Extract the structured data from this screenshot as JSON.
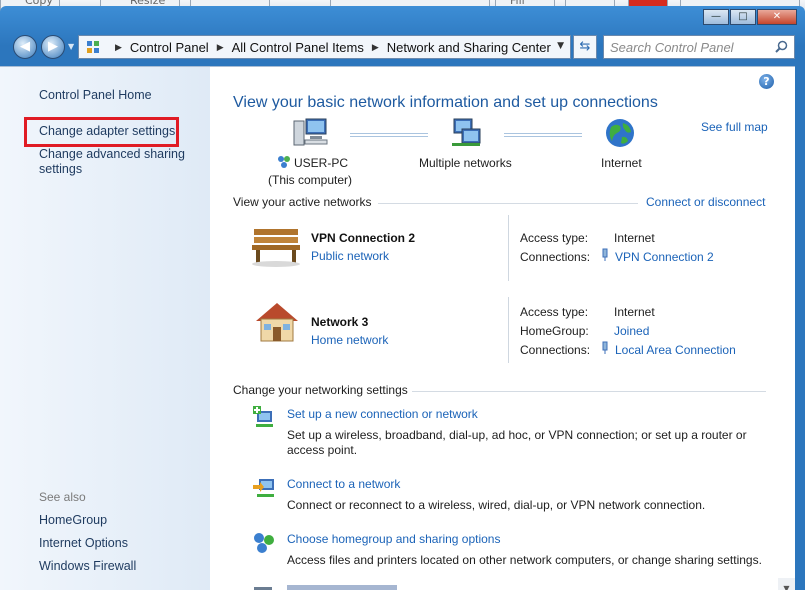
{
  "bg_toolbar": {
    "copy_label": "Copy",
    "resize_label": "Resize",
    "fill_label": "Fill"
  },
  "window_controls": {
    "minimize": "—",
    "maximize": "□",
    "close": "✕"
  },
  "address": {
    "crumbs": [
      "Control Panel",
      "All Control Panel Items",
      "Network and Sharing Center"
    ],
    "search_placeholder": "Search Control Panel"
  },
  "sidebar": {
    "home": "Control Panel Home",
    "change_adapter": "Change adapter settings",
    "change_advanced_1": "Change advanced sharing",
    "change_advanced_2": "settings",
    "see_also": "See also",
    "see_also_items": [
      "HomeGroup",
      "Internet Options",
      "Windows Firewall"
    ]
  },
  "main": {
    "title": "View your basic network information and set up connections",
    "see_full_map": "See full map",
    "map": {
      "computer": "USER-PC",
      "computer_sub": "(This computer)",
      "networks": "Multiple networks",
      "internet": "Internet"
    },
    "active_header": "View your active networks",
    "connect_disconnect": "Connect or disconnect",
    "networks": [
      {
        "name": "VPN Connection 2",
        "category": "Public network",
        "rows": [
          {
            "label": "Access type:",
            "value": "Internet",
            "link": false
          },
          {
            "label": "Connections:",
            "value": "VPN Connection 2",
            "link": true
          }
        ]
      },
      {
        "name": "Network  3",
        "category": "Home network",
        "rows": [
          {
            "label": "Access type:",
            "value": "Internet",
            "link": false
          },
          {
            "label": "HomeGroup:",
            "value": "Joined",
            "link": true
          },
          {
            "label": "Connections:",
            "value": "Local Area Connection",
            "link": true
          }
        ]
      }
    ],
    "settings_header": "Change your networking settings",
    "settings": [
      {
        "title": "Set up a new connection or network",
        "desc1": "Set up a wireless, broadband, dial-up, ad hoc, or VPN connection; or set up a router or",
        "desc2": "access point."
      },
      {
        "title": "Connect to a network",
        "desc1": "Connect or reconnect to a wireless, wired, dial-up, or VPN network connection.",
        "desc2": ""
      },
      {
        "title": "Choose homegroup and sharing options",
        "desc1": "Access files and printers located on other network computers, or change sharing settings.",
        "desc2": ""
      }
    ]
  }
}
